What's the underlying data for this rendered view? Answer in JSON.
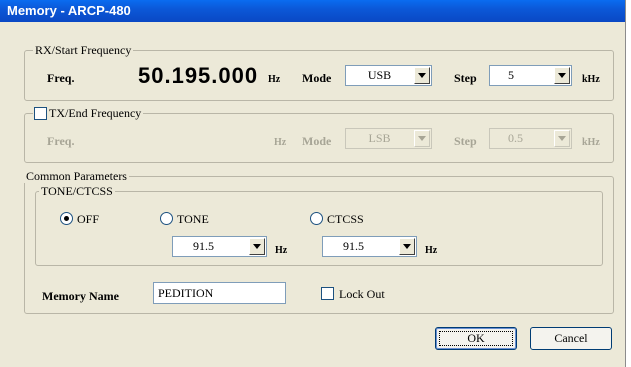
{
  "window": {
    "title": "Memory - ARCP-480"
  },
  "rx": {
    "legend": "RX/Start Frequency",
    "freq_label": "Freq.",
    "freq_value": "50.195.000",
    "freq_unit": "Hz",
    "mode_label": "Mode",
    "mode_value": "USB",
    "step_label": "Step",
    "step_value": "5",
    "step_unit": "kHz"
  },
  "tx": {
    "legend": "TX/End Frequency",
    "checked": false,
    "freq_label": "Freq.",
    "freq_unit": "Hz",
    "mode_label": "Mode",
    "mode_value": "LSB",
    "step_label": "Step",
    "step_value": "0.5",
    "step_unit": "kHz"
  },
  "common": {
    "legend": "Common Parameters",
    "tone_legend": "TONE/CTCSS",
    "off_label": "OFF",
    "tone_label": "TONE",
    "ctcss_label": "CTCSS",
    "selected": "OFF",
    "tone_value": "91.5",
    "tone_unit": "Hz",
    "ctcss_value": "91.5",
    "ctcss_unit": "Hz",
    "memory_name_label": "Memory Name",
    "memory_name_value": "PEDITION",
    "lock_out_label": "Lock Out",
    "lock_out_checked": false
  },
  "buttons": {
    "ok": "OK",
    "cancel": "Cancel"
  }
}
